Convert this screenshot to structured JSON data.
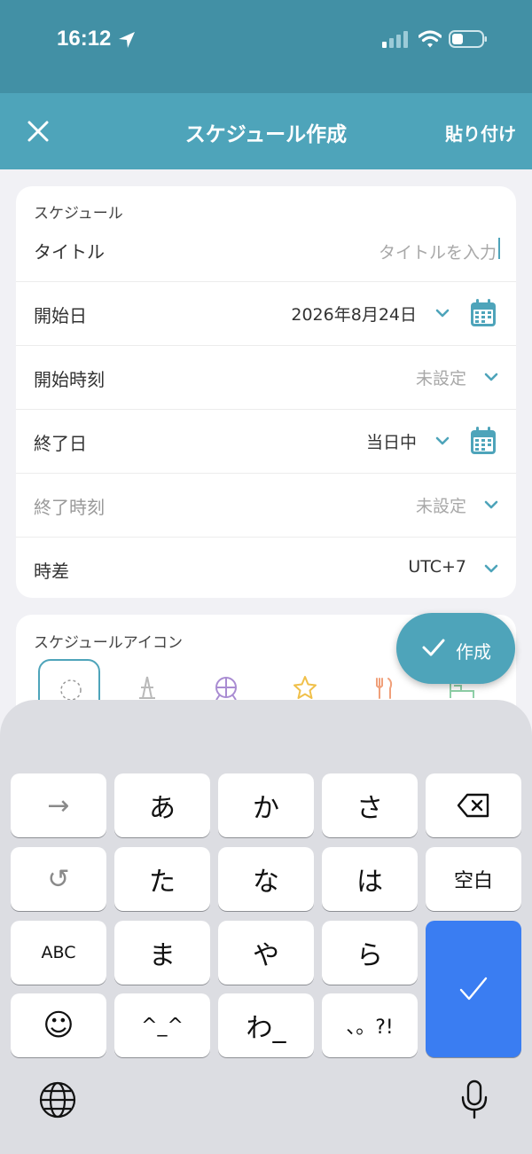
{
  "status_bar": {
    "time": "16:12"
  },
  "nav": {
    "title": "スケジュール作成",
    "paste_label": "貼り付け"
  },
  "schedule": {
    "section_label": "スケジュール",
    "title_label": "タイトル",
    "title_placeholder": "タイトルを入力",
    "start_date_label": "開始日",
    "start_date_value": "2026年8月24日",
    "start_time_label": "開始時刻",
    "start_time_value": "未設定",
    "end_date_label": "終了日",
    "end_date_value": "当日中",
    "end_time_label": "終了時刻",
    "end_time_value": "未設定",
    "timezone_label": "時差",
    "timezone_value": "UTC+7"
  },
  "icons_section": {
    "label": "スケジュールアイコン",
    "icons": [
      "none-icon",
      "tower-icon",
      "ferris-wheel-icon",
      "star-icon",
      "restaurant-icon",
      "bed-icon"
    ]
  },
  "fab": {
    "label": "作成"
  },
  "keyboard": {
    "rows": [
      [
        "→",
        "あ",
        "か",
        "さ",
        "⌫"
      ],
      [
        "↺",
        "た",
        "な",
        "は",
        "空白"
      ],
      [
        "ABC",
        "ま",
        "や",
        "ら"
      ],
      [
        "☺",
        "^_^",
        "わ_",
        "、。?!"
      ]
    ]
  },
  "colors": {
    "primary": "#4ea4ba",
    "status_bar": "#4290a5",
    "enter": "#3a7df2"
  }
}
